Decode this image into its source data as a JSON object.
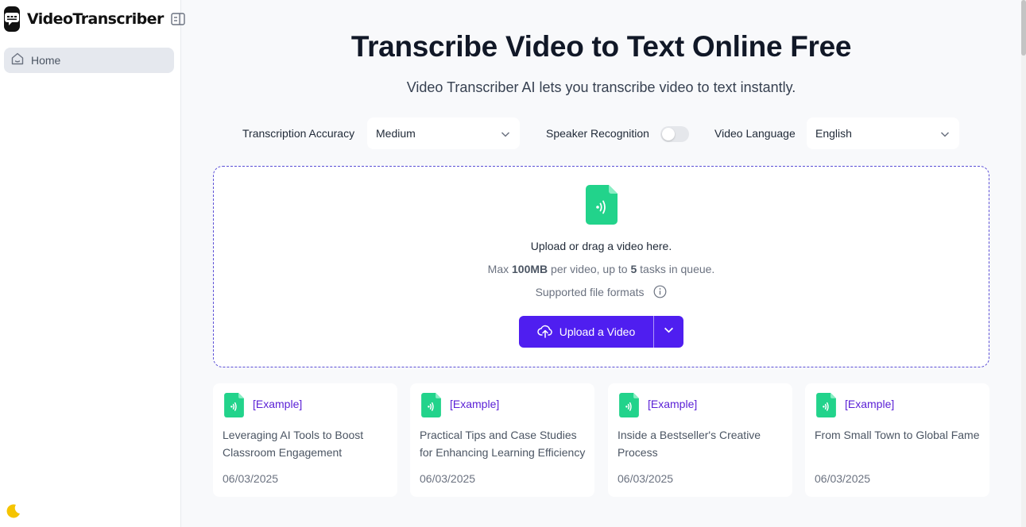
{
  "sidebar": {
    "brand": "VideoTranscriber",
    "nav": [
      {
        "label": "Home",
        "icon": "home-icon"
      }
    ]
  },
  "main": {
    "title": "Transcribe Video to Text Online Free",
    "subtitle": "Video Transcriber AI lets you transcribe video to text instantly.",
    "options": {
      "accuracy_label": "Transcription Accuracy",
      "accuracy_value": "Medium",
      "speaker_label": "Speaker Recognition",
      "speaker_enabled": false,
      "language_label": "Video Language",
      "language_value": "English"
    },
    "dropzone": {
      "line1": "Upload or drag a video here.",
      "max_prefix": "Max",
      "max_size": "100MB",
      "max_mid": "per video, up to",
      "max_tasks": "5",
      "max_suffix": "tasks in queue.",
      "formats_label": "Supported file formats",
      "upload_label": "Upload a Video"
    },
    "examples": [
      {
        "tag": "[Example]",
        "title": "Leveraging AI Tools to Boost Classroom Engagement",
        "date": "06/03/2025"
      },
      {
        "tag": "[Example]",
        "title": "Practical Tips and Case Studies for Enhancing Learning Efficiency",
        "date": "06/03/2025"
      },
      {
        "tag": "[Example]",
        "title": "Inside a Bestseller's Creative Process",
        "date": "06/03/2025"
      },
      {
        "tag": "[Example]",
        "title": "From Small Town to Global Fame",
        "date": "06/03/2025"
      }
    ]
  },
  "colors": {
    "accent": "#4f1ef0",
    "file_icon": "#22d38b",
    "example_tag": "#5b21d6",
    "moon": "#f5c400"
  }
}
